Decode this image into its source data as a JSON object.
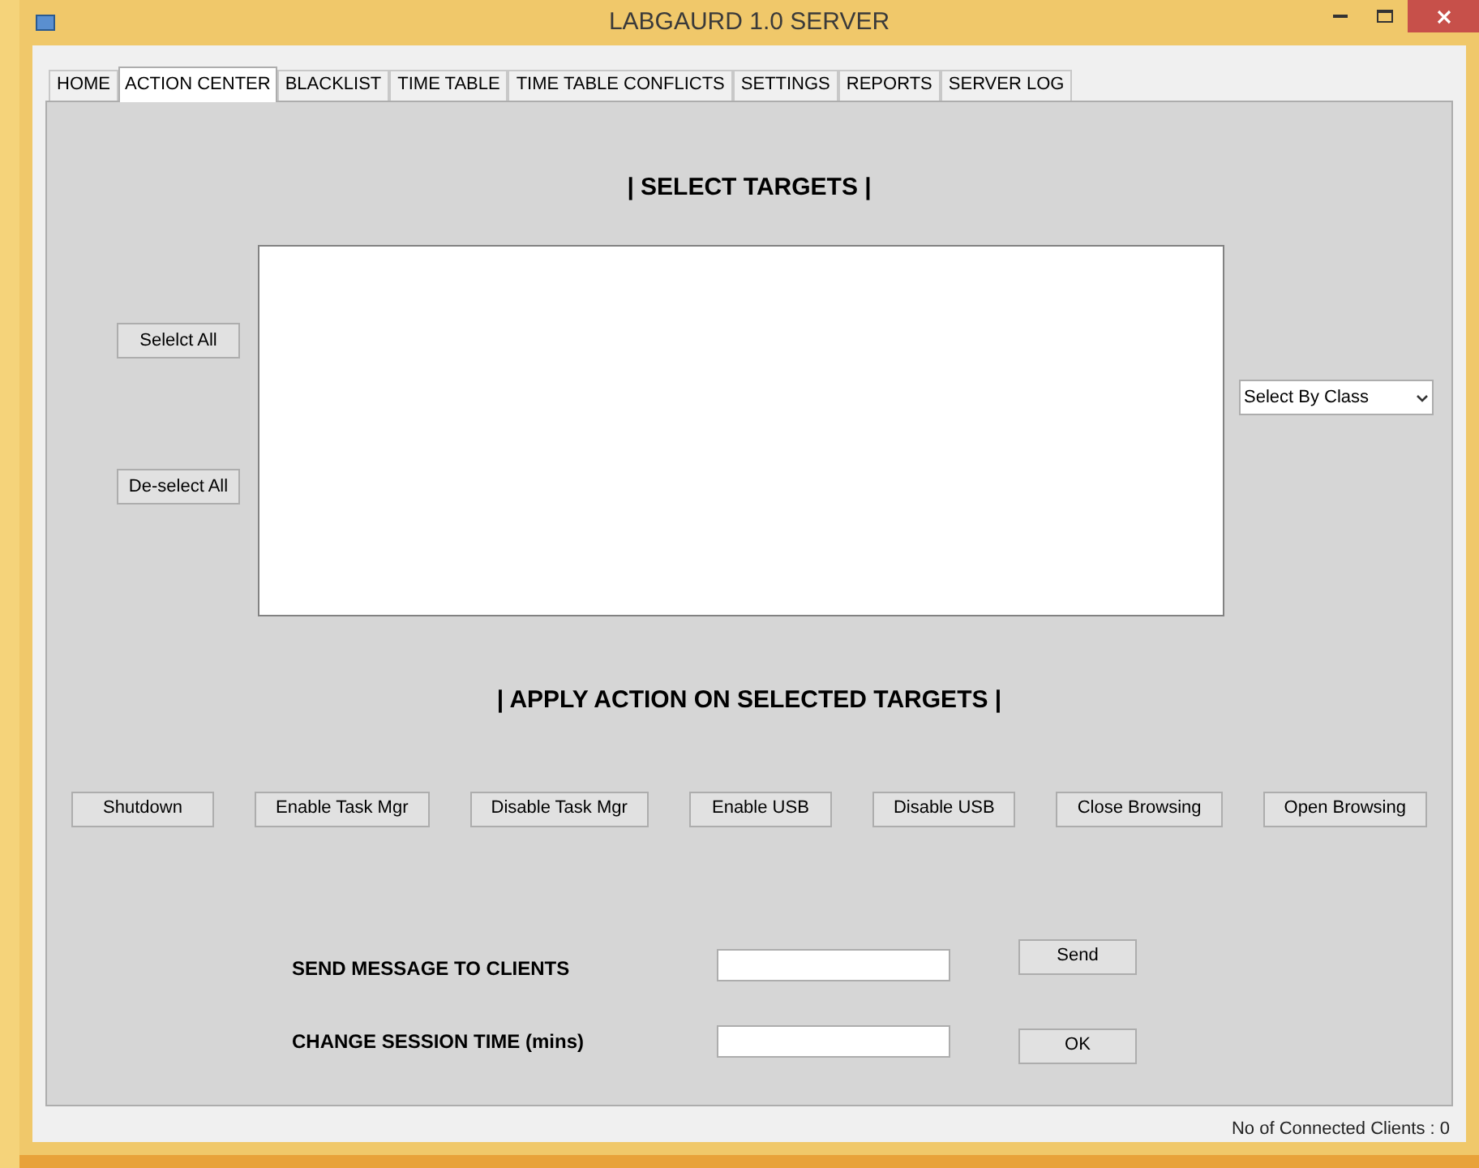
{
  "window": {
    "title": "LABGAURD 1.0 SERVER"
  },
  "tabs": [
    {
      "label": "HOME",
      "selected": false
    },
    {
      "label": "ACTION CENTER",
      "selected": true
    },
    {
      "label": "BLACKLIST",
      "selected": false
    },
    {
      "label": "TIME TABLE",
      "selected": false
    },
    {
      "label": "TIME TABLE CONFLICTS",
      "selected": false
    },
    {
      "label": "SETTINGS",
      "selected": false
    },
    {
      "label": "REPORTS",
      "selected": false
    },
    {
      "label": "SERVER LOG",
      "selected": false
    }
  ],
  "targets": {
    "heading": "| SELECT TARGETS |",
    "select_all": "Selelct All",
    "deselect_all": "De-select All",
    "class_dropdown": "Select By Class"
  },
  "actions": {
    "heading": "| APPLY ACTION ON SELECTED TARGETS |",
    "buttons": [
      "Shutdown",
      "Enable Task Mgr",
      "Disable Task Mgr",
      "Enable USB",
      "Disable USB",
      "Close Browsing",
      "Open Browsing"
    ]
  },
  "message": {
    "label": "SEND MESSAGE TO CLIENTS",
    "button": "Send"
  },
  "session": {
    "label": "CHANGE SESSION TIME (mins)",
    "button": "OK"
  },
  "status_bar": "No of Connected Clients : 0"
}
